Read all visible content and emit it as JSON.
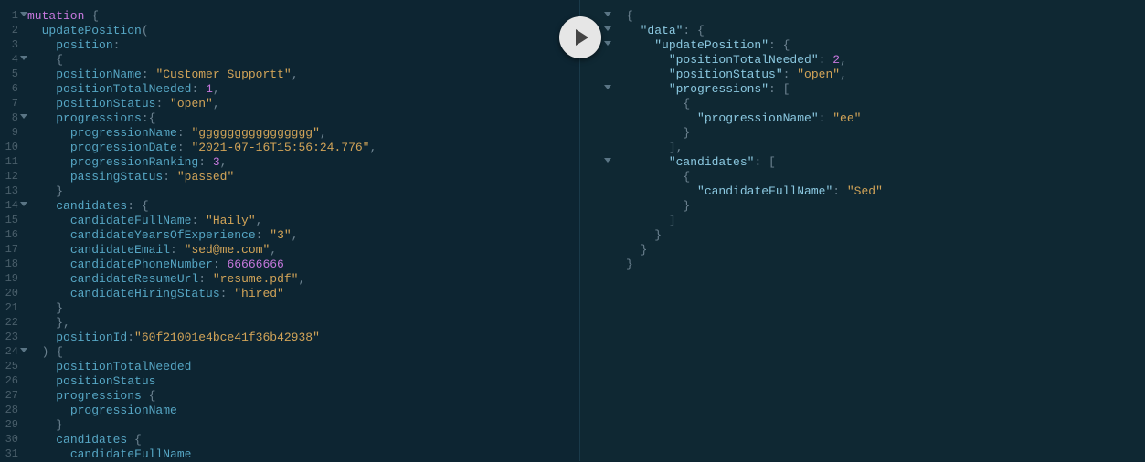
{
  "query": {
    "lines": [
      {
        "n": 1,
        "foldable": true,
        "tokens": [
          [
            "kw",
            "mutation"
          ],
          [
            "punc",
            " {"
          ]
        ]
      },
      {
        "n": 2,
        "tokens": [
          [
            "plain",
            "  "
          ],
          [
            "field",
            "updatePosition"
          ],
          [
            "punc",
            "("
          ]
        ]
      },
      {
        "n": 3,
        "tokens": [
          [
            "plain",
            "    "
          ],
          [
            "field",
            "position"
          ],
          [
            "punc",
            ":"
          ]
        ]
      },
      {
        "n": 4,
        "foldable": true,
        "tokens": [
          [
            "plain",
            "    "
          ],
          [
            "punc",
            "{"
          ]
        ]
      },
      {
        "n": 5,
        "tokens": [
          [
            "plain",
            "    "
          ],
          [
            "field",
            "positionName"
          ],
          [
            "punc",
            ": "
          ],
          [
            "str",
            "\"Customer Supportt\""
          ],
          [
            "punc",
            ","
          ]
        ]
      },
      {
        "n": 6,
        "tokens": [
          [
            "plain",
            "    "
          ],
          [
            "field",
            "positionTotalNeeded"
          ],
          [
            "punc",
            ": "
          ],
          [
            "num",
            "1"
          ],
          [
            "punc",
            ","
          ]
        ]
      },
      {
        "n": 7,
        "tokens": [
          [
            "plain",
            "    "
          ],
          [
            "field",
            "positionStatus"
          ],
          [
            "punc",
            ": "
          ],
          [
            "str",
            "\"open\""
          ],
          [
            "punc",
            ","
          ]
        ]
      },
      {
        "n": 8,
        "foldable": true,
        "tokens": [
          [
            "plain",
            "    "
          ],
          [
            "field",
            "progressions"
          ],
          [
            "punc",
            ":{"
          ]
        ]
      },
      {
        "n": 9,
        "tokens": [
          [
            "plain",
            "      "
          ],
          [
            "field",
            "progressionName"
          ],
          [
            "punc",
            ": "
          ],
          [
            "str",
            "\"gggggggggggggggg\""
          ],
          [
            "punc",
            ","
          ]
        ]
      },
      {
        "n": 10,
        "tokens": [
          [
            "plain",
            "      "
          ],
          [
            "field",
            "progressionDate"
          ],
          [
            "punc",
            ": "
          ],
          [
            "str",
            "\"2021-07-16T15:56:24.776\""
          ],
          [
            "punc",
            ","
          ]
        ]
      },
      {
        "n": 11,
        "tokens": [
          [
            "plain",
            "      "
          ],
          [
            "field",
            "progressionRanking"
          ],
          [
            "punc",
            ": "
          ],
          [
            "num",
            "3"
          ],
          [
            "punc",
            ","
          ]
        ]
      },
      {
        "n": 12,
        "tokens": [
          [
            "plain",
            "      "
          ],
          [
            "field",
            "passingStatus"
          ],
          [
            "punc",
            ": "
          ],
          [
            "str",
            "\"passed\""
          ]
        ]
      },
      {
        "n": 13,
        "tokens": [
          [
            "plain",
            "    "
          ],
          [
            "punc",
            "}"
          ]
        ]
      },
      {
        "n": 14,
        "foldable": true,
        "tokens": [
          [
            "plain",
            "    "
          ],
          [
            "field",
            "candidates"
          ],
          [
            "punc",
            ": {"
          ]
        ]
      },
      {
        "n": 15,
        "tokens": [
          [
            "plain",
            "      "
          ],
          [
            "field",
            "candidateFullName"
          ],
          [
            "punc",
            ": "
          ],
          [
            "str",
            "\"Haily\""
          ],
          [
            "punc",
            ","
          ]
        ]
      },
      {
        "n": 16,
        "tokens": [
          [
            "plain",
            "      "
          ],
          [
            "field",
            "candidateYearsOfExperience"
          ],
          [
            "punc",
            ": "
          ],
          [
            "str",
            "\"3\""
          ],
          [
            "punc",
            ","
          ]
        ]
      },
      {
        "n": 17,
        "tokens": [
          [
            "plain",
            "      "
          ],
          [
            "field",
            "candidateEmail"
          ],
          [
            "punc",
            ": "
          ],
          [
            "str",
            "\"sed@me.com\""
          ],
          [
            "punc",
            ","
          ]
        ]
      },
      {
        "n": 18,
        "tokens": [
          [
            "plain",
            "      "
          ],
          [
            "field",
            "candidatePhoneNumber"
          ],
          [
            "punc",
            ": "
          ],
          [
            "num",
            "66666666"
          ]
        ]
      },
      {
        "n": 19,
        "tokens": [
          [
            "plain",
            "      "
          ],
          [
            "field",
            "candidateResumeUrl"
          ],
          [
            "punc",
            ": "
          ],
          [
            "str",
            "\"resume.pdf\""
          ],
          [
            "punc",
            ","
          ]
        ]
      },
      {
        "n": 20,
        "tokens": [
          [
            "plain",
            "      "
          ],
          [
            "field",
            "candidateHiringStatus"
          ],
          [
            "punc",
            ": "
          ],
          [
            "str",
            "\"hired\""
          ]
        ]
      },
      {
        "n": 21,
        "tokens": [
          [
            "plain",
            "    "
          ],
          [
            "punc",
            "}"
          ]
        ]
      },
      {
        "n": 22,
        "tokens": [
          [
            "plain",
            "    "
          ],
          [
            "punc",
            "},"
          ]
        ]
      },
      {
        "n": 23,
        "tokens": [
          [
            "plain",
            "    "
          ],
          [
            "field",
            "positionId"
          ],
          [
            "punc",
            ":"
          ],
          [
            "str",
            "\"60f21001e4bce41f36b42938\""
          ]
        ]
      },
      {
        "n": 24,
        "foldable": true,
        "tokens": [
          [
            "plain",
            "  "
          ],
          [
            "punc",
            ") {"
          ]
        ]
      },
      {
        "n": 25,
        "tokens": [
          [
            "plain",
            "    "
          ],
          [
            "field",
            "positionTotalNeeded"
          ]
        ]
      },
      {
        "n": 26,
        "tokens": [
          [
            "plain",
            "    "
          ],
          [
            "field",
            "positionStatus"
          ]
        ]
      },
      {
        "n": 27,
        "tokens": [
          [
            "plain",
            "    "
          ],
          [
            "field",
            "progressions"
          ],
          [
            "punc",
            " {"
          ]
        ]
      },
      {
        "n": 28,
        "tokens": [
          [
            "plain",
            "      "
          ],
          [
            "field",
            "progressionName"
          ]
        ]
      },
      {
        "n": 29,
        "tokens": [
          [
            "plain",
            "    "
          ],
          [
            "punc",
            "}"
          ]
        ]
      },
      {
        "n": 30,
        "tokens": [
          [
            "plain",
            "    "
          ],
          [
            "field",
            "candidates"
          ],
          [
            "punc",
            " {"
          ]
        ]
      },
      {
        "n": 31,
        "tokens": [
          [
            "plain",
            "      "
          ],
          [
            "field",
            "candidateFullName"
          ]
        ]
      }
    ]
  },
  "response": {
    "lines": [
      {
        "foldable": true,
        "tokens": [
          [
            "punc",
            "{"
          ]
        ]
      },
      {
        "foldable": true,
        "tokens": [
          [
            "plain",
            "  "
          ],
          [
            "key",
            "\"data\""
          ],
          [
            "punc",
            ": {"
          ]
        ]
      },
      {
        "foldable": true,
        "tokens": [
          [
            "plain",
            "    "
          ],
          [
            "key",
            "\"updatePosition\""
          ],
          [
            "punc",
            ": {"
          ]
        ]
      },
      {
        "tokens": [
          [
            "plain",
            "      "
          ],
          [
            "key",
            "\"positionTotalNeeded\""
          ],
          [
            "punc",
            ": "
          ],
          [
            "num",
            "2"
          ],
          [
            "punc",
            ","
          ]
        ]
      },
      {
        "tokens": [
          [
            "plain",
            "      "
          ],
          [
            "key",
            "\"positionStatus\""
          ],
          [
            "punc",
            ": "
          ],
          [
            "str",
            "\"open\""
          ],
          [
            "punc",
            ","
          ]
        ]
      },
      {
        "foldable": true,
        "tokens": [
          [
            "plain",
            "      "
          ],
          [
            "key",
            "\"progressions\""
          ],
          [
            "punc",
            ": ["
          ]
        ]
      },
      {
        "tokens": [
          [
            "plain",
            "        "
          ],
          [
            "punc",
            "{"
          ]
        ]
      },
      {
        "tokens": [
          [
            "plain",
            "          "
          ],
          [
            "key",
            "\"progressionName\""
          ],
          [
            "punc",
            ": "
          ],
          [
            "str",
            "\"ee\""
          ]
        ]
      },
      {
        "tokens": [
          [
            "plain",
            "        "
          ],
          [
            "punc",
            "}"
          ]
        ]
      },
      {
        "tokens": [
          [
            "plain",
            "      "
          ],
          [
            "punc",
            "],"
          ]
        ]
      },
      {
        "foldable": true,
        "tokens": [
          [
            "plain",
            "      "
          ],
          [
            "key",
            "\"candidates\""
          ],
          [
            "punc",
            ": ["
          ]
        ]
      },
      {
        "tokens": [
          [
            "plain",
            "        "
          ],
          [
            "punc",
            "{"
          ]
        ]
      },
      {
        "tokens": [
          [
            "plain",
            "          "
          ],
          [
            "key",
            "\"candidateFullName\""
          ],
          [
            "punc",
            ": "
          ],
          [
            "str",
            "\"Sed\""
          ]
        ]
      },
      {
        "tokens": [
          [
            "plain",
            "        "
          ],
          [
            "punc",
            "}"
          ]
        ]
      },
      {
        "tokens": [
          [
            "plain",
            "      "
          ],
          [
            "punc",
            "]"
          ]
        ]
      },
      {
        "tokens": [
          [
            "plain",
            "    "
          ],
          [
            "punc",
            "}"
          ]
        ]
      },
      {
        "tokens": [
          [
            "plain",
            "  "
          ],
          [
            "punc",
            "}"
          ]
        ]
      },
      {
        "tokens": [
          [
            "punc",
            "}"
          ]
        ]
      }
    ]
  }
}
